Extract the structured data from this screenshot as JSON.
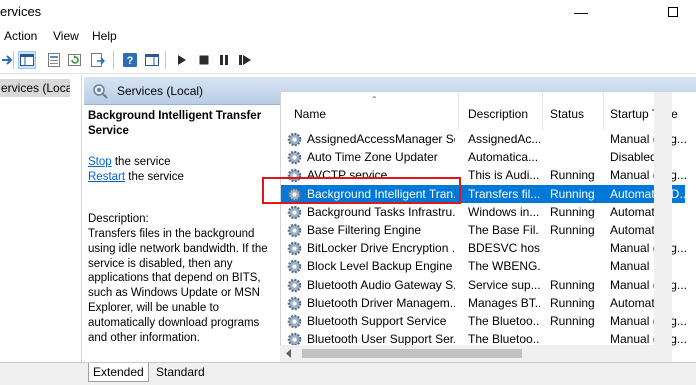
{
  "window": {
    "title": "ervices"
  },
  "menu": {
    "items": [
      "Action",
      "View",
      "Help"
    ]
  },
  "tree": {
    "selected_item": "ervices (Local)"
  },
  "header": {
    "title": "Services (Local)"
  },
  "description": {
    "service_name": "Background Intelligent Transfer Service",
    "stop_link": "Stop",
    "stop_rest": " the service",
    "restart_link": "Restart",
    "restart_rest": " the service",
    "label": "Description:",
    "text": "Transfers files in the background using idle network bandwidth. If the service is disabled, then any applications that depend on BITS, such as Windows Update or MSN Explorer, will be unable to automatically download programs and other information."
  },
  "columns": [
    "Name",
    "Description",
    "Status",
    "Startup Type"
  ],
  "rows": [
    {
      "name": "AssignedAccessManager Se...",
      "desc": "AssignedAc...",
      "status": "",
      "startup": "Manual (Trig..."
    },
    {
      "name": "Auto Time Zone Updater",
      "desc": "Automatica...",
      "status": "",
      "startup": "Disabled"
    },
    {
      "name": "AVCTP service",
      "desc": "This is Audi...",
      "status": "Running",
      "startup": "Manual (Trig..."
    },
    {
      "name": "Background Intelligent Tran...",
      "desc": "Transfers fil...",
      "status": "Running",
      "startup": "Automatic (D..."
    },
    {
      "name": "Background Tasks Infrastru...",
      "desc": "Windows in...",
      "status": "Running",
      "startup": "Automatic"
    },
    {
      "name": "Base Filtering Engine",
      "desc": "The Base Fil...",
      "status": "Running",
      "startup": "Automatic"
    },
    {
      "name": "BitLocker Drive Encryption ...",
      "desc": "BDESVC hos...",
      "status": "",
      "startup": "Manual (Trig..."
    },
    {
      "name": "Block Level Backup Engine ...",
      "desc": "The WBENG...",
      "status": "",
      "startup": "Manual"
    },
    {
      "name": "Bluetooth Audio Gateway S...",
      "desc": "Service sup...",
      "status": "Running",
      "startup": "Manual (Trig..."
    },
    {
      "name": "Bluetooth Driver Managem...",
      "desc": "Manages BT...",
      "status": "Running",
      "startup": "Automatic"
    },
    {
      "name": "Bluetooth Support Service",
      "desc": "The Bluetoo...",
      "status": "Running",
      "startup": "Manual (Trig..."
    },
    {
      "name": "Bluetooth User Support Ser...",
      "desc": "The Bluetoo...",
      "status": "",
      "startup": "Manual (Trig..."
    }
  ],
  "tabs": {
    "extended": "Extended",
    "standard": "Standard"
  },
  "colors": {
    "selection": "#0078d7",
    "highlight_box": "#e0161b",
    "header_band": "#c7d7ec"
  }
}
